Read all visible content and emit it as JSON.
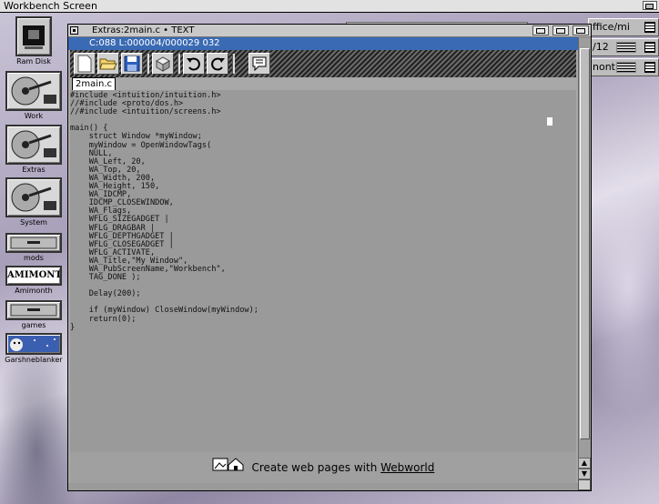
{
  "screen": {
    "title": "Workbench Screen"
  },
  "background_windows": [
    {
      "label": "ffice/mi"
    },
    {
      "label": "/12"
    },
    {
      "label": "nonth"
    }
  ],
  "desktop_icons": [
    {
      "name": "ram-disk",
      "label": "Ram Disk"
    },
    {
      "name": "work",
      "label": "Work"
    },
    {
      "name": "extras",
      "label": "Extras"
    },
    {
      "name": "system",
      "label": "System"
    },
    {
      "name": "mods",
      "label": "mods"
    },
    {
      "name": "amimonth",
      "label": "Amimonth",
      "art_text": "AMIMONTH"
    },
    {
      "name": "games",
      "label": "games"
    },
    {
      "name": "garshneblanker",
      "label": "Garshneblanker"
    }
  ],
  "editor_window": {
    "title": "Extras:2main.c • TEXT",
    "status": "C:088 L:000004/000029 032",
    "tooltip": "2main.c",
    "toolbar": [
      "new-document",
      "open-folder",
      "save-disk",
      "print",
      "undo",
      "redo",
      "comment"
    ],
    "code": "#include <intuition/intuition.h>\n//#include <proto/dos.h>\n//#include <intuition/screens.h>\n\nmain() {\n    struct Window *myWindow;\n    myWindow = OpenWindowTags(\n    NULL,\n    WA_Left, 20,\n    WA_Top, 20,\n    WA_Width, 200,\n    WA_Height, 150,\n    WA_IDCMP,\n    IDCMP_CLOSEWINDOW,\n    WA_Flags,\n    WFLG_SIZEGADGET |\n    WFLG_DRAGBAR |\n    WFLG_DEPTHGADGET |\n    WFLG_CLOSEGADGET |\n    WFLG_ACTIVATE,\n    WA_Title,\"My Window\",\n    WA_PubScreenName,\"Workbench\",\n    TAG_DONE );\n\n    Delay(200);\n\n    if (myWindow) CloseWindow(myWindow);\n    return(0);\n}",
    "banner": {
      "text": "Create web pages with",
      "link": "Webworld"
    }
  },
  "colors": {
    "status_bar": "#3a6ab3",
    "editor_bg": "#9a9a9a"
  }
}
